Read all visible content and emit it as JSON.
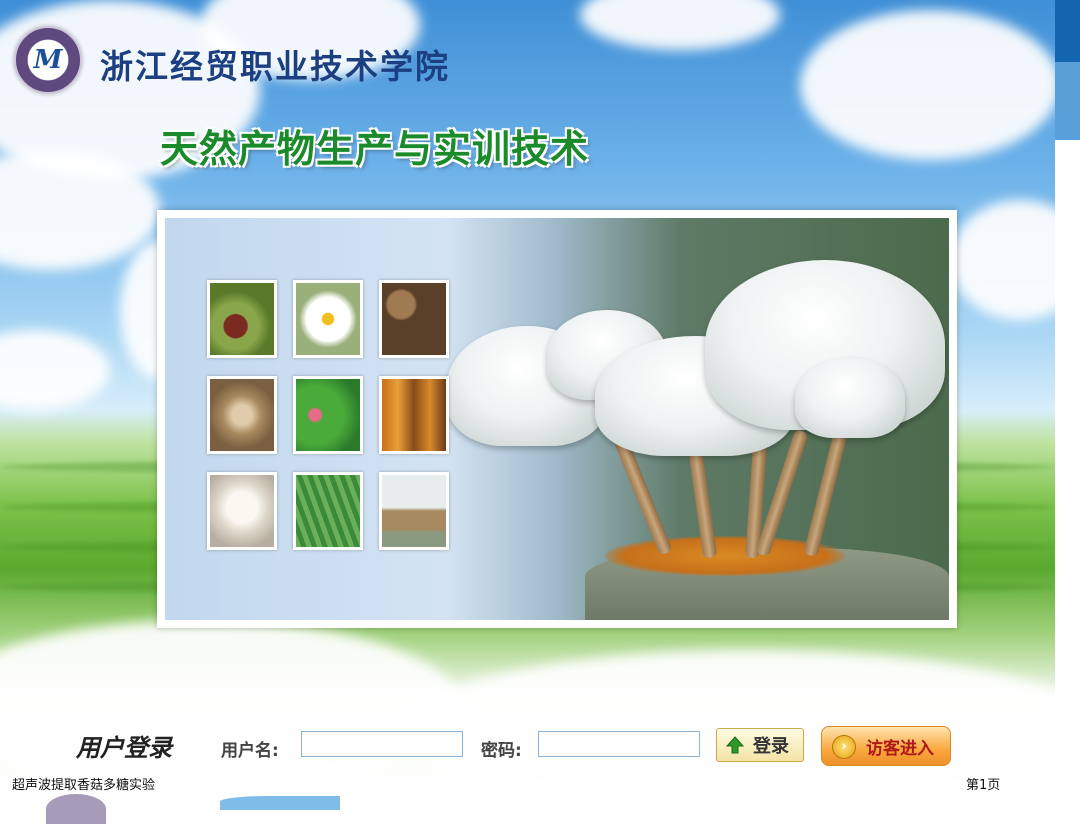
{
  "header": {
    "logo_text": "M",
    "school_name": "浙江经贸职业技术学院",
    "course_title": "天然产物生产与实训技术"
  },
  "gallery": {
    "thumbnails": [
      {
        "icon": "dates-photo-icon",
        "color": "#7a2a20"
      },
      {
        "icon": "chrysanthemum-photo-icon",
        "color": "#f4f4f0"
      },
      {
        "icon": "shiitake-photo-icon",
        "color": "#8a6a44"
      },
      {
        "icon": "shells-photo-icon",
        "color": "#b8a078"
      },
      {
        "icon": "lotus-photo-icon",
        "color": "#3a9a3a"
      },
      {
        "icon": "hanging-mushrooms-photo-icon",
        "color": "#c88a2a"
      },
      {
        "icon": "garlic-photo-icon",
        "color": "#e8e4dc"
      },
      {
        "icon": "herb-photo-icon",
        "color": "#5aa04a"
      },
      {
        "icon": "white-mushroom-photo-icon",
        "color": "#d8dcd8"
      }
    ],
    "hero": {
      "icon": "porcelain-mushroom-photo-icon"
    }
  },
  "login": {
    "title": "用户登录",
    "username_label": "用户名:",
    "username_value": "",
    "password_label": "密码:",
    "password_value": "",
    "login_button": "登录",
    "guest_button": "访客进入"
  },
  "footer": {
    "left_text": "超声波提取香菇多糖实验",
    "page_label": "第1页"
  }
}
